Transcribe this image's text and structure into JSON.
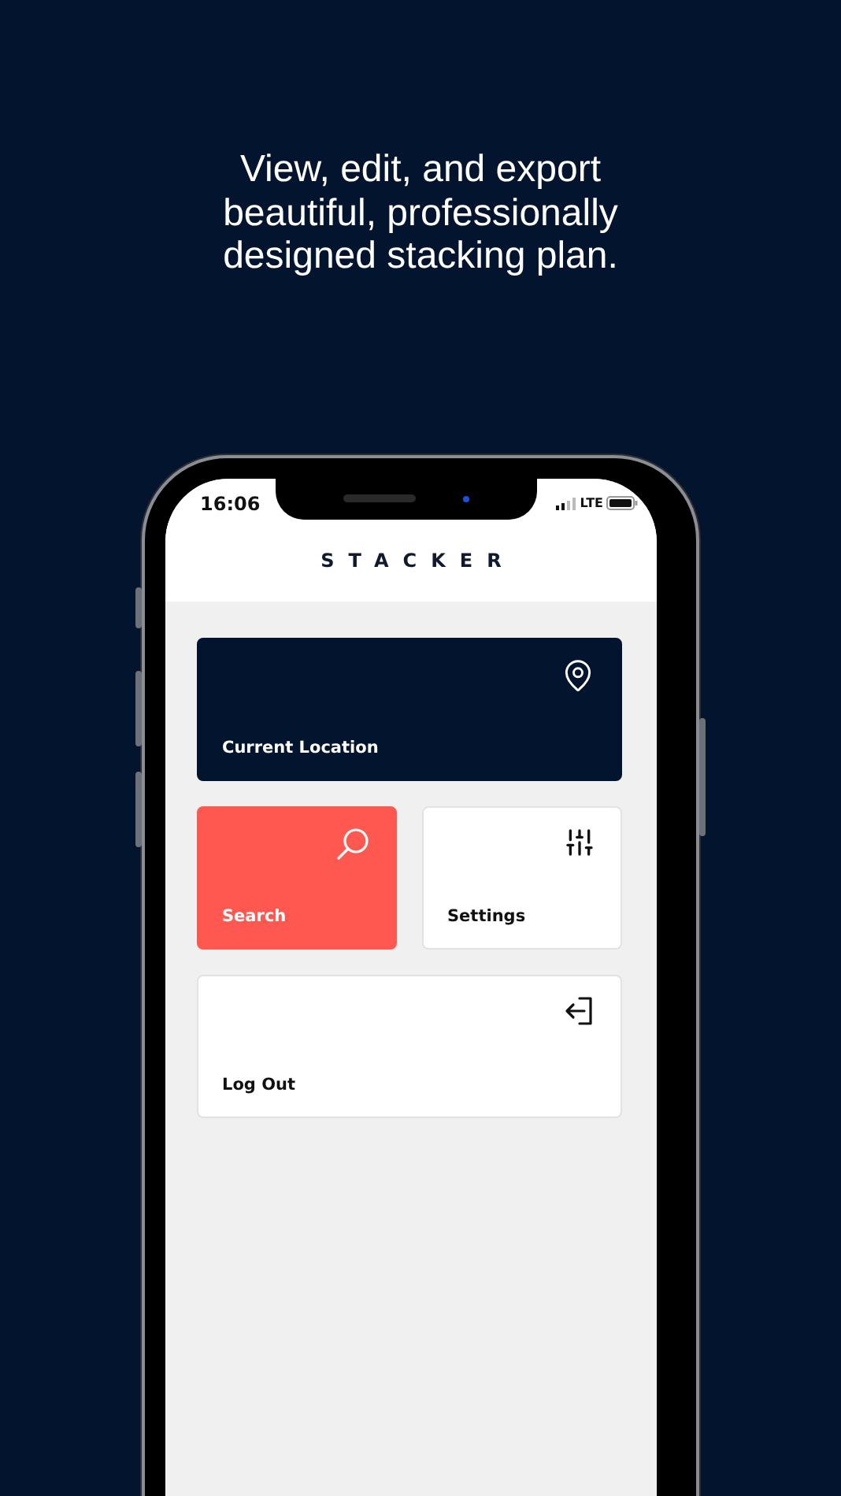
{
  "headline": "View, edit, and export beautiful, professionally designed stacking plan.",
  "status_bar": {
    "time": "16:06",
    "network": "LTE"
  },
  "app": {
    "title": "STACKER"
  },
  "tiles": [
    {
      "label": "Current Location",
      "kind": "location",
      "color": "#03152e"
    },
    {
      "label": "Search",
      "kind": "search",
      "color": "#fe5850"
    },
    {
      "label": "Settings",
      "kind": "settings",
      "color": "#ffffff"
    },
    {
      "label": "Log Out",
      "kind": "logout",
      "color": "#ffffff"
    }
  ]
}
